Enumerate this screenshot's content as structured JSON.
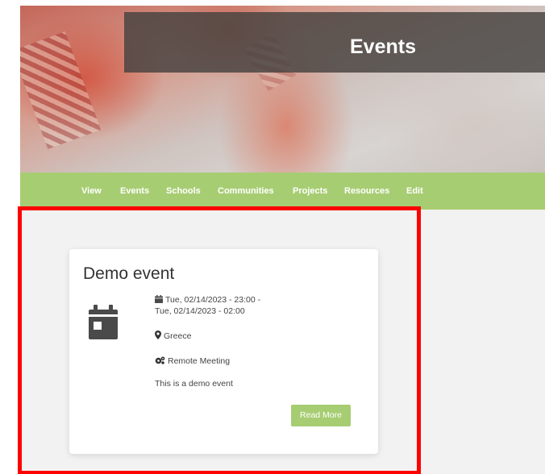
{
  "hero": {
    "title": "Events"
  },
  "nav": {
    "items": [
      {
        "label": "View"
      },
      {
        "label": "Events"
      },
      {
        "label": "Schools"
      },
      {
        "label": "Communities"
      },
      {
        "label": "Projects"
      },
      {
        "label": "Resources"
      },
      {
        "label": "Edit"
      }
    ]
  },
  "event_card": {
    "title": "Demo event",
    "icon": "calendar-icon",
    "date_line1": "Tue, 02/14/2023 - 23:00 -",
    "date_line2": "Tue, 02/14/2023 - 02:00",
    "location": "Greece",
    "type": "Remote Meeting",
    "description": "This is a demo event",
    "read_more_label": "Read More"
  },
  "colors": {
    "accent": "#a7cd73",
    "highlight": "#ff0000",
    "title_panel": "#464240"
  }
}
